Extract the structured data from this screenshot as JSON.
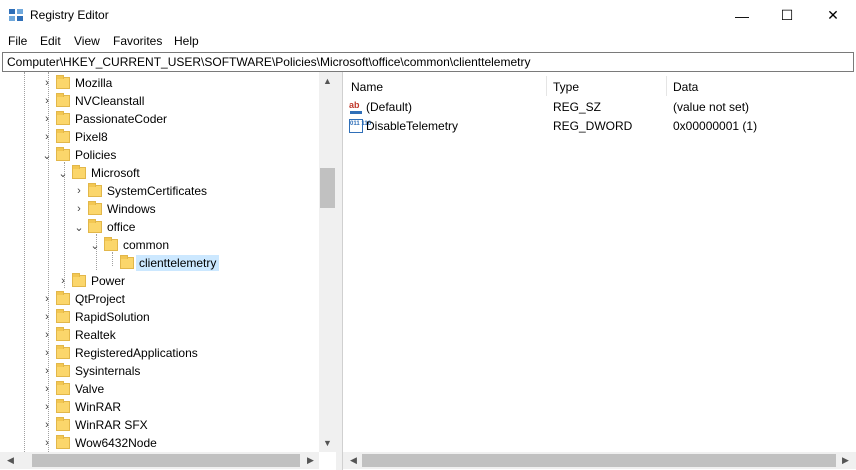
{
  "window": {
    "title": "Registry Editor",
    "app_icon": "regedit-icon",
    "minimize": "—",
    "maximize": "☐",
    "close": "✕"
  },
  "menu": [
    "File",
    "Edit",
    "View",
    "Favorites",
    "Help"
  ],
  "address": "Computer\\HKEY_CURRENT_USER\\SOFTWARE\\Policies\\Microsoft\\office\\common\\clienttelemetry",
  "tree": [
    {
      "label": "Mozilla",
      "depth": 0,
      "expander": "collapsed"
    },
    {
      "label": "NVCleanstall",
      "depth": 0,
      "expander": "collapsed"
    },
    {
      "label": "PassionateCoder",
      "depth": 0,
      "expander": "collapsed"
    },
    {
      "label": "Pixel8",
      "depth": 0,
      "expander": "collapsed"
    },
    {
      "label": "Policies",
      "depth": 0,
      "expander": "expanded"
    },
    {
      "label": "Microsoft",
      "depth": 1,
      "expander": "expanded"
    },
    {
      "label": "SystemCertificates",
      "depth": 2,
      "expander": "collapsed"
    },
    {
      "label": "Windows",
      "depth": 2,
      "expander": "collapsed"
    },
    {
      "label": "office",
      "depth": 2,
      "expander": "expanded"
    },
    {
      "label": "common",
      "depth": 3,
      "expander": "expanded"
    },
    {
      "label": "clienttelemetry",
      "depth": 4,
      "expander": "none",
      "selected": true
    },
    {
      "label": "Power",
      "depth": 1,
      "expander": "collapsed"
    },
    {
      "label": "QtProject",
      "depth": 0,
      "expander": "collapsed"
    },
    {
      "label": "RapidSolution",
      "depth": 0,
      "expander": "collapsed"
    },
    {
      "label": "Realtek",
      "depth": 0,
      "expander": "collapsed"
    },
    {
      "label": "RegisteredApplications",
      "depth": 0,
      "expander": "collapsed"
    },
    {
      "label": "Sysinternals",
      "depth": 0,
      "expander": "collapsed"
    },
    {
      "label": "Valve",
      "depth": 0,
      "expander": "collapsed"
    },
    {
      "label": "WinRAR",
      "depth": 0,
      "expander": "collapsed"
    },
    {
      "label": "WinRAR SFX",
      "depth": 0,
      "expander": "collapsed"
    },
    {
      "label": "Wow6432Node",
      "depth": 0,
      "expander": "collapsed"
    }
  ],
  "columns": {
    "name": "Name",
    "type": "Type",
    "data": "Data"
  },
  "values": [
    {
      "icon": "string-value-icon",
      "icon_text": "ab",
      "name": "(Default)",
      "type": "REG_SZ",
      "data": "(value not set)"
    },
    {
      "icon": "binary-value-icon",
      "icon_text": "011 110",
      "name": "DisableTelemetry",
      "type": "REG_DWORD",
      "data": "0x00000001 (1)"
    }
  ],
  "colors": {
    "selection": "#cce8ff",
    "folder": "#fbd66b",
    "scrollbar": "#f0f0f0",
    "thumb": "#c1c1c1"
  }
}
